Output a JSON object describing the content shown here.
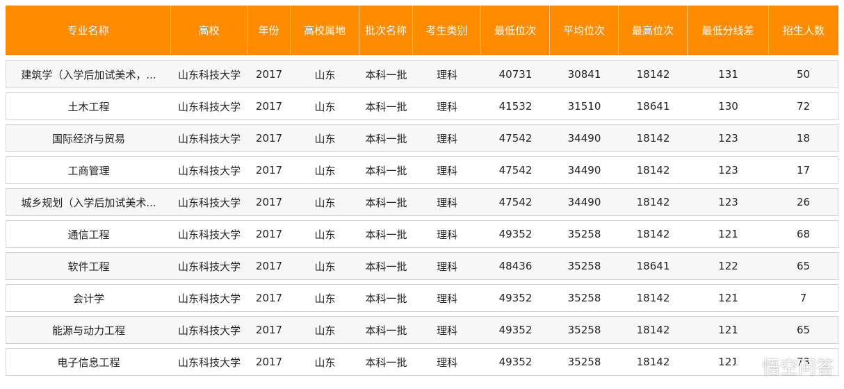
{
  "table": {
    "headers": [
      "专业名称",
      "高校",
      "年份",
      "高校属地",
      "批次名称",
      "考生类别",
      "最低位次",
      "平均位次",
      "最高位次",
      "最低分线差",
      "招生人数"
    ],
    "rows": [
      [
        "建筑学（入学后加试美术，...",
        "山东科技大学",
        "2017",
        "山东",
        "本科一批",
        "理科",
        "40731",
        "30841",
        "18142",
        "131",
        "50"
      ],
      [
        "土木工程",
        "山东科技大学",
        "2017",
        "山东",
        "本科一批",
        "理科",
        "41532",
        "31510",
        "18641",
        "130",
        "72"
      ],
      [
        "国际经济与贸易",
        "山东科技大学",
        "2017",
        "山东",
        "本科一批",
        "理科",
        "47542",
        "34490",
        "18142",
        "123",
        "18"
      ],
      [
        "工商管理",
        "山东科技大学",
        "2017",
        "山东",
        "本科一批",
        "理科",
        "47542",
        "34490",
        "18142",
        "123",
        "17"
      ],
      [
        "城乡规划（入学后加试美术...",
        "山东科技大学",
        "2017",
        "山东",
        "本科一批",
        "理科",
        "47542",
        "34490",
        "18142",
        "123",
        "26"
      ],
      [
        "通信工程",
        "山东科技大学",
        "2017",
        "山东",
        "本科一批",
        "理科",
        "49352",
        "35258",
        "18142",
        "121",
        "68"
      ],
      [
        "软件工程",
        "山东科技大学",
        "2017",
        "山东",
        "本科一批",
        "理科",
        "48436",
        "35258",
        "18641",
        "122",
        "65"
      ],
      [
        "会计学",
        "山东科技大学",
        "2017",
        "山东",
        "本科一批",
        "理科",
        "49352",
        "35258",
        "18142",
        "121",
        "7"
      ],
      [
        "能源与动力工程",
        "山东科技大学",
        "2017",
        "山东",
        "本科一批",
        "理科",
        "49352",
        "35258",
        "18142",
        "121",
        "65"
      ],
      [
        "电子信息工程",
        "山东科技大学",
        "2017",
        "山东",
        "本科一批",
        "理科",
        "49352",
        "35258",
        "18142",
        "121",
        "73"
      ]
    ]
  },
  "watermark": {
    "text": "悟空问答",
    "icon": "wukong-logo-icon"
  },
  "colors": {
    "header_bg": "#ff8c00",
    "header_text": "#ffffff",
    "row_alt_bg": "#f7f7f7",
    "border": "#d2d2d2"
  }
}
